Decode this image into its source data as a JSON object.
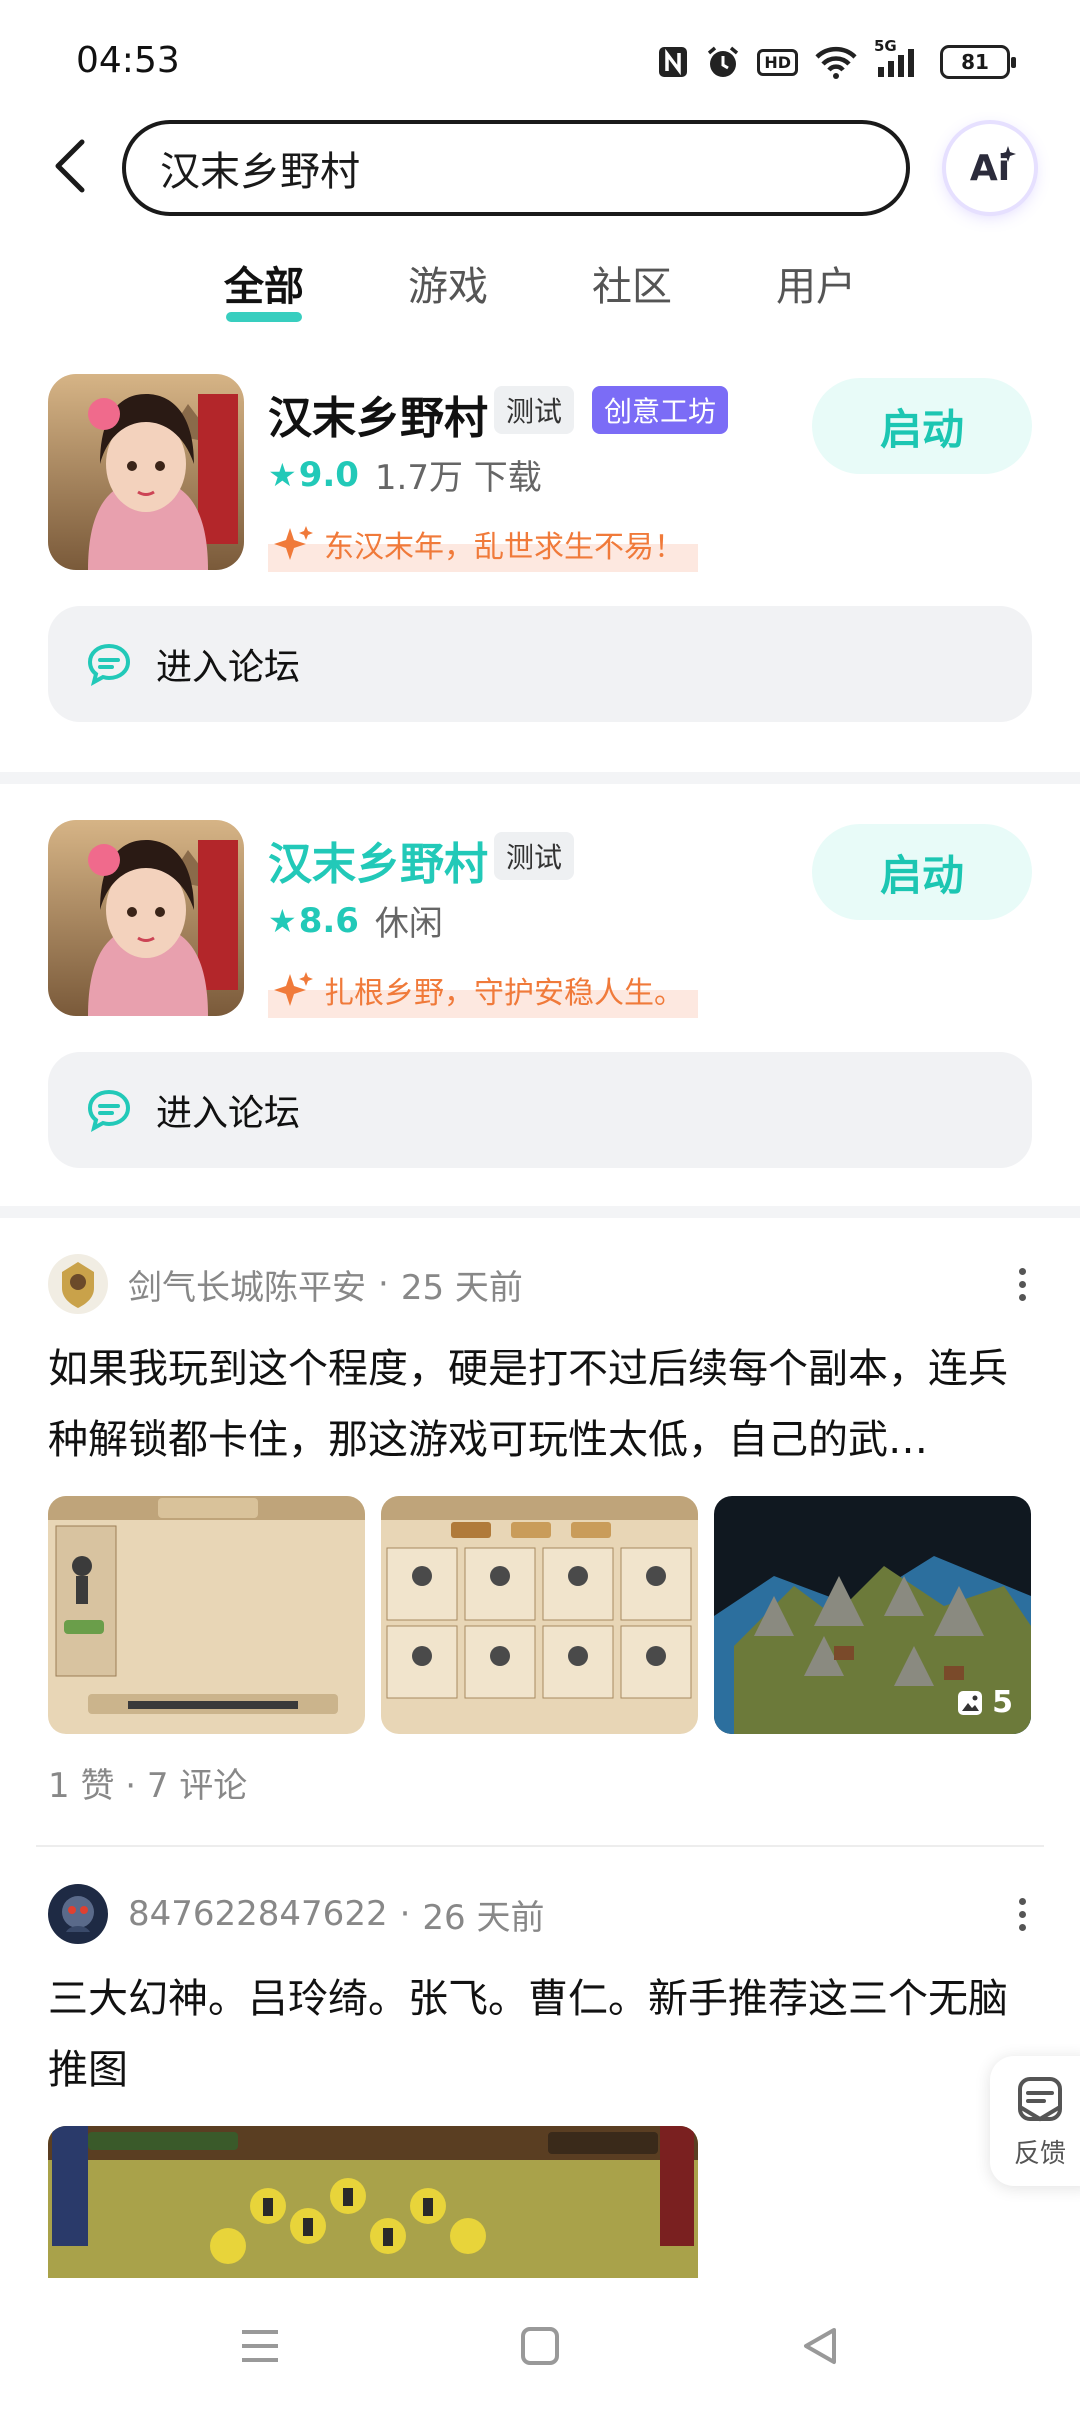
{
  "status_bar": {
    "time": "04:53",
    "battery": "81",
    "hd": "HD",
    "network": "5G"
  },
  "search": {
    "query": "汉末乡野村"
  },
  "ai_button": {
    "label": "Ai"
  },
  "tabs": [
    {
      "label": "全部",
      "active": true
    },
    {
      "label": "游戏",
      "active": false
    },
    {
      "label": "社区",
      "active": false
    },
    {
      "label": "用户",
      "active": false
    }
  ],
  "games": [
    {
      "title": "汉末乡野村",
      "tags": [
        "测试",
        "创意工坊"
      ],
      "rating": "9.0",
      "meta": "1.7万 下载",
      "slogan": "东汉末年，乱世求生不易！",
      "launch_label": "启动",
      "forum_label": "进入论坛"
    },
    {
      "title": "汉末乡野村",
      "tags": [
        "测试"
      ],
      "rating": "8.6",
      "meta": "休闲",
      "slogan": "扎根乡野，守护安稳人生。",
      "launch_label": "启动",
      "forum_label": "进入论坛"
    }
  ],
  "posts": [
    {
      "author": "剑气长城陈平安",
      "time": "25 天前",
      "text": "如果我玩到这个程度，硬是打不过后续每个副本，连兵种解锁都卡住，那这游戏可玩性太低，自己的武…",
      "image_count": "5",
      "stats": "1 赞 · 7 评论"
    },
    {
      "author": "847622847622",
      "time": "26 天前",
      "text": "三大幻神。吕玲绮。张飞。曹仁。新手推荐这三个无脑推图"
    }
  ],
  "feedback": {
    "label": "反馈"
  },
  "colors": {
    "accent": "#22c9b8",
    "creative_tag": "#7b6cf6",
    "slogan": "#f07a3a"
  }
}
